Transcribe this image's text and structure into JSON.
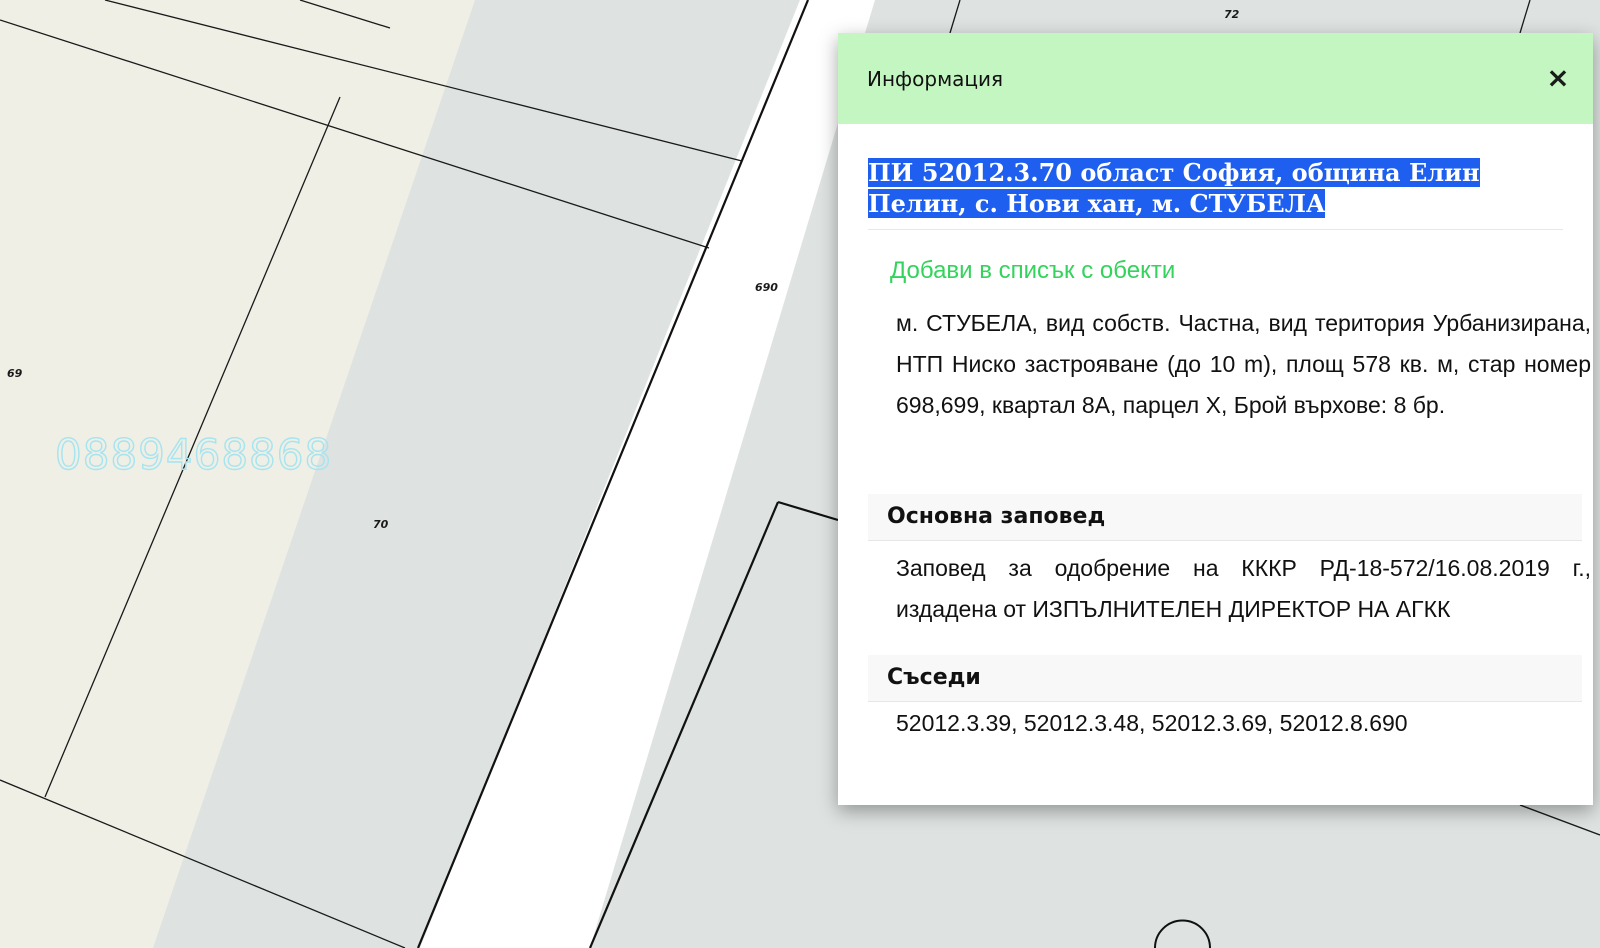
{
  "map": {
    "parcel_labels": [
      "72",
      "69",
      "690",
      "70"
    ],
    "watermark": "0889468868",
    "colors": {
      "beige": "#efefe6",
      "gray": "#dee3e1",
      "road": "#ffffff",
      "line": "#1a1a1a"
    }
  },
  "info": {
    "title": "Информация",
    "close_icon": "×",
    "parcel_heading": "ПИ 52012.3.70 област София, община Елин Пелин, с. Нови хан, м. СТУБЕЛА",
    "add_link": "Добави в списък с обекти",
    "description": "м. СТУБЕЛА, вид собств. Частна, вид територия Урбанизирана, НТП Ниско застрояване (до 10 m), площ 578 кв. м, стар номер 698,699, квартал 8А, парцел Х, Брой върхове: 8 бр.",
    "order_heading": "Основна заповед",
    "order_text": "Заповед за одобрение на КККР РД-18-572/16.08.2019 г., издадена от ИЗПЪЛНИТЕЛЕН ДИРЕКТОР НА АГКК",
    "neighbors_heading": "Съседи",
    "neighbors_text": "52012.3.39, 52012.3.48, 52012.3.69, 52012.8.690"
  }
}
